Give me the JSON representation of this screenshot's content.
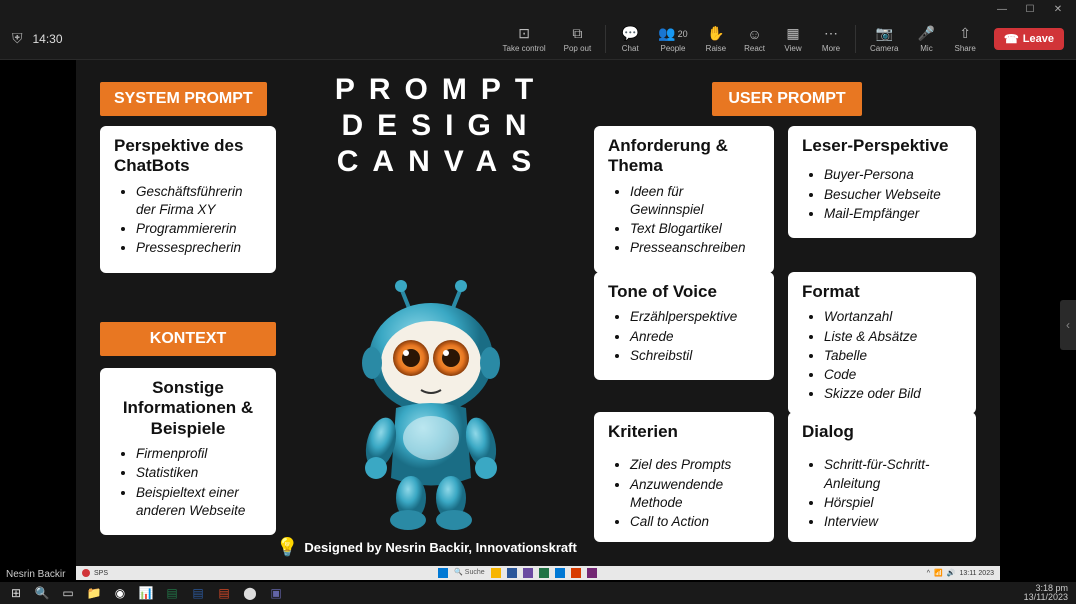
{
  "window": {
    "minimize": "—",
    "maximize": "☐",
    "close": "✕"
  },
  "toolbar": {
    "timer": "14:30",
    "take_control": "Take control",
    "popout": "Pop out",
    "chat": "Chat",
    "people": "People",
    "people_count": "20",
    "raise": "Raise",
    "react": "React",
    "view": "View",
    "more": "More",
    "camera": "Camera",
    "mic": "Mic",
    "share": "Share",
    "leave": "Leave"
  },
  "slide": {
    "title_l1": "PROMPT",
    "title_l2": "DESIGN",
    "title_l3": "CANVAS",
    "credit": "Designed by Nesrin Backir, Innovationskraft",
    "badges": {
      "system_prompt": "SYSTEM PROMPT",
      "kontext": "KONTEXT",
      "user_prompt": "USER PROMPT"
    },
    "left": {
      "card1": {
        "heading": "Perspektive des ChatBots",
        "items": [
          "Geschäftsführerin der Firma XY",
          "Programmiererin",
          "Pressesprecherin"
        ]
      },
      "card2": {
        "heading": "Sonstige Informationen & Beispiele",
        "items": [
          "Firmenprofil",
          "Statistiken",
          "Beispieltext einer anderen Webseite"
        ]
      }
    },
    "col1": {
      "card1": {
        "heading": "Anforderung & Thema",
        "items": [
          "Ideen für Gewinnspiel",
          "Text Blogartikel",
          "Presseanschreiben"
        ]
      },
      "card2": {
        "heading": "Tone of Voice",
        "items": [
          "Erzählperspektive",
          "Anrede",
          "Schreibstil"
        ]
      },
      "card3": {
        "heading": "Kriterien",
        "items": [
          "Ziel des Prompts",
          "Anzuwendende Methode",
          "Call to Action"
        ]
      }
    },
    "col2": {
      "card1": {
        "heading": "Leser-Perspektive",
        "items": [
          "Buyer-Persona",
          "Besucher Webseite",
          "Mail-Empfänger"
        ]
      },
      "card2": {
        "heading": "Format",
        "items": [
          "Wortanzahl",
          "Liste & Absätze",
          "Tabelle",
          "Code",
          "Skizze oder Bild"
        ]
      },
      "card3": {
        "heading": "Dialog",
        "items": [
          "Schritt-für-Schritt-Anleitung",
          "Hörspiel",
          "Interview"
        ]
      }
    }
  },
  "presenter": "Nesrin Backir",
  "vm_taskbar": {
    "search": "Suche",
    "time": "13:11 2023"
  },
  "host_taskbar": {
    "time": "3:18 pm",
    "date": "13/11/2023"
  },
  "colors": {
    "accent": "#e87722",
    "leave": "#d13438"
  }
}
